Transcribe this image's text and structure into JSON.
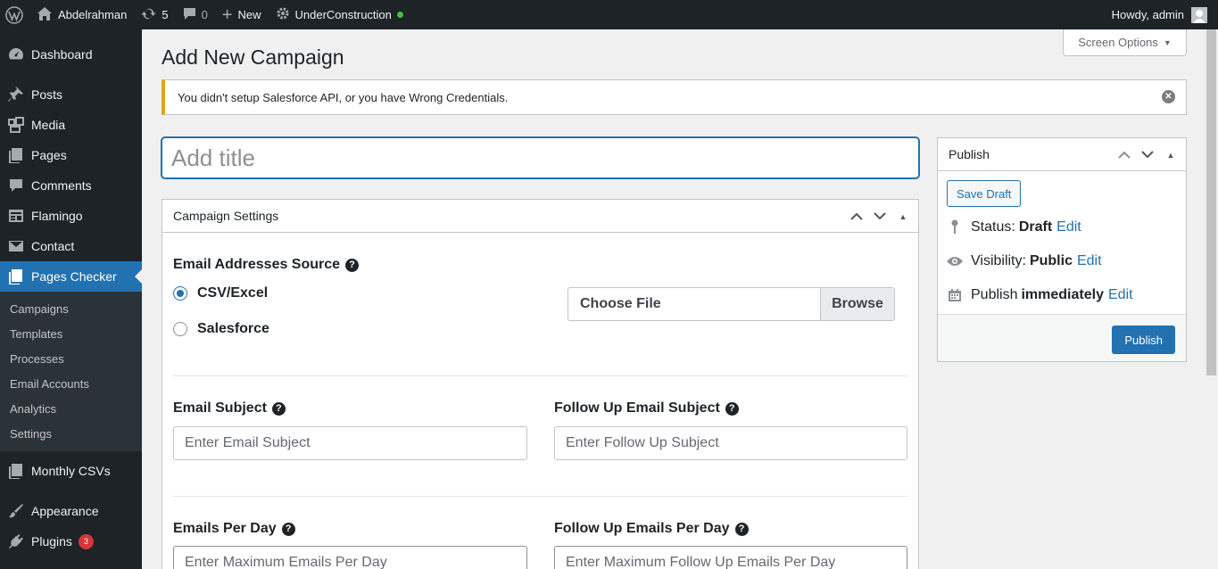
{
  "adminbar": {
    "site_name": "Abdelrahman",
    "updates_count": "5",
    "comments_count": "0",
    "new_label": "New",
    "maintenance_label": "UnderConstruction",
    "howdy": "Howdy, admin"
  },
  "sidebar": {
    "items": [
      {
        "label": "Dashboard",
        "icon": "dashboard-icon"
      },
      {
        "label": "Posts",
        "icon": "pin-icon"
      },
      {
        "label": "Media",
        "icon": "media-icon"
      },
      {
        "label": "Pages",
        "icon": "pages-icon"
      },
      {
        "label": "Comments",
        "icon": "comment-icon"
      },
      {
        "label": "Flamingo",
        "icon": "feed-icon"
      },
      {
        "label": "Contact",
        "icon": "envelope-icon"
      },
      {
        "label": "Pages Checker",
        "icon": "pages-icon"
      }
    ],
    "submenu": [
      "Campaigns",
      "Templates",
      "Processes",
      "Email Accounts",
      "Analytics",
      "Settings"
    ],
    "after": [
      {
        "label": "Monthly CSVs",
        "icon": "pages-icon"
      },
      {
        "label": "Appearance",
        "icon": "brush-icon"
      },
      {
        "label": "Plugins",
        "icon": "plug-icon",
        "badge": "3"
      }
    ]
  },
  "screen_options": "Screen Options",
  "page_title": "Add New Campaign",
  "notice": "You didn't setup Salesforce API, or you have Wrong Credentials.",
  "title_placeholder": "Add title",
  "campaign": {
    "header": "Campaign Settings",
    "source_label": "Email Addresses Source",
    "source_options": [
      "CSV/Excel",
      "Salesforce"
    ],
    "selected_source": "CSV/Excel",
    "file_choose": "Choose File",
    "file_browse": "Browse",
    "subject_label": "Email Subject",
    "subject_placeholder": "Enter Email Subject",
    "followup_subject_label": "Follow Up Email Subject",
    "followup_subject_placeholder": "Enter Follow Up Subject",
    "per_day_label": "Emails Per Day",
    "per_day_placeholder": "Enter Maximum Emails Per Day",
    "followup_per_day_label": "Follow Up Emails Per Day",
    "followup_per_day_placeholder": "Enter Maximum Follow Up Emails Per Day"
  },
  "publish": {
    "header": "Publish",
    "save_draft": "Save Draft",
    "status_label": "Status:",
    "status_value": "Draft",
    "visibility_label": "Visibility:",
    "visibility_value": "Public",
    "publish_label": "Publish",
    "publish_value": "immediately",
    "edit": "Edit",
    "publish_button": "Publish"
  }
}
